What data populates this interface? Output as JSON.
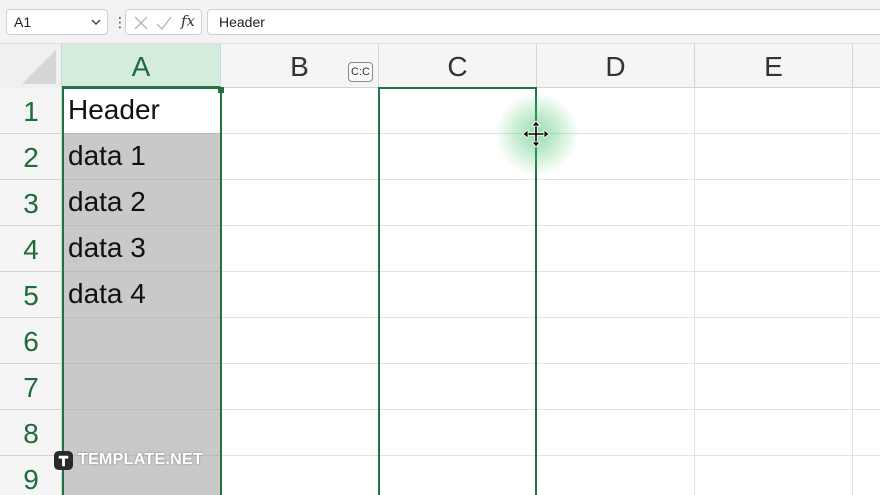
{
  "formula_bar": {
    "name_box": "A1",
    "formula_value": "Header",
    "fx_label": "fx"
  },
  "columns": [
    {
      "label": "A",
      "selected": true
    },
    {
      "label": "B",
      "selected": false
    },
    {
      "label": "C",
      "selected": false
    },
    {
      "label": "D",
      "selected": false
    },
    {
      "label": "E",
      "selected": false
    }
  ],
  "rows": [
    "1",
    "2",
    "3",
    "4",
    "5",
    "6",
    "7",
    "8",
    "9"
  ],
  "cells": {
    "A1": "Header",
    "A2": "data 1",
    "A3": "data 2",
    "A4": "data 3",
    "A5": "data 4"
  },
  "column_badge": "C:C",
  "watermark": "TEMPLATE.NET",
  "colors": {
    "accent": "#217346",
    "selected_header_bg": "#d3ecdb",
    "selection_fill": "#c9c9c9"
  },
  "icons": {
    "cancel": "cancel-icon",
    "confirm": "check-icon",
    "move_cursor": "move-cursor-icon"
  }
}
